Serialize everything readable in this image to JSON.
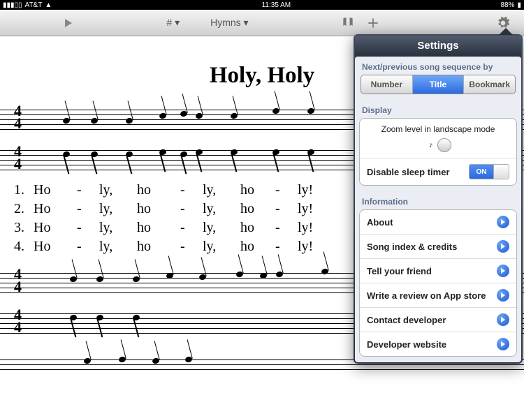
{
  "statusbar": {
    "carrier": "AT&T",
    "time": "11:35 AM",
    "battery": "88%"
  },
  "toolbar": {
    "number_label": "# ▾",
    "category_label": "Hymns ▾"
  },
  "hymn": {
    "title": "Holy, Holy",
    "verses": [
      {
        "num": "1.",
        "s": [
          "Ho",
          "-",
          "ly,",
          "ho",
          "-",
          "ly,",
          "ho",
          "-",
          "ly!"
        ]
      },
      {
        "num": "2.",
        "s": [
          "Ho",
          "-",
          "ly,",
          "ho",
          "-",
          "ly,",
          "ho",
          "-",
          "ly!"
        ]
      },
      {
        "num": "3.",
        "s": [
          "Ho",
          "-",
          "ly,",
          "ho",
          "-",
          "ly,",
          "ho",
          "-",
          "ly!"
        ]
      },
      {
        "num": "4.",
        "s": [
          "Ho",
          "-",
          "ly,",
          "ho",
          "-",
          "ly,",
          "ho",
          "-",
          "ly!"
        ]
      }
    ]
  },
  "settings": {
    "title": "Settings",
    "sequence": {
      "label": "Next/previous song sequence by",
      "options": [
        "Number",
        "Title",
        "Bookmark"
      ],
      "selected_index": 1
    },
    "display": {
      "label": "Display",
      "zoom_label": "Zoom level in landscape mode",
      "sleep_label": "Disable sleep timer",
      "sleep_on": "ON"
    },
    "information": {
      "label": "Information",
      "items": [
        "About",
        "Song index & credits",
        "Tell your friend",
        "Write a review on App store",
        "Contact developer",
        "Developer website"
      ]
    }
  }
}
